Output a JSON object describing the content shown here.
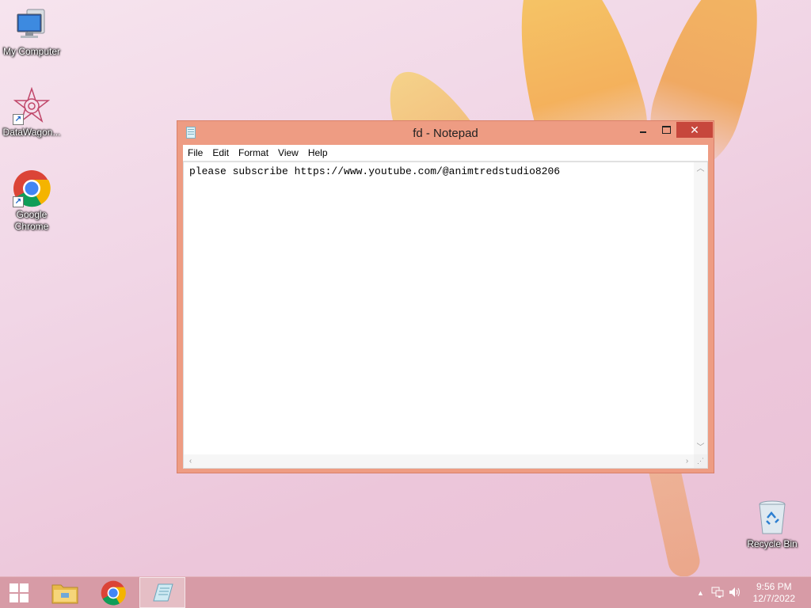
{
  "desktop": {
    "icons": [
      {
        "label": "My Computer",
        "icon": "computer-icon"
      },
      {
        "label": "DataWagon...",
        "icon": "datawagon-icon"
      },
      {
        "label": "Google Chrome",
        "icon": "chrome-icon"
      },
      {
        "label": "Recycle Bin",
        "icon": "recycle-bin-icon"
      }
    ]
  },
  "notepad": {
    "title": "fd - Notepad",
    "menu": [
      "File",
      "Edit",
      "Format",
      "View",
      "Help"
    ],
    "content": "please subscribe https://www.youtube.com/@animtredstudio8206",
    "controls": {
      "minimize": "minimize-icon",
      "maximize": "maximize-icon",
      "close": "✕"
    }
  },
  "taskbar": {
    "pinned": [
      {
        "name": "start",
        "icon": "windows-icon"
      },
      {
        "name": "file-explorer",
        "icon": "folder-icon"
      },
      {
        "name": "chrome",
        "icon": "chrome-icon"
      },
      {
        "name": "notepad",
        "icon": "notepad-icon",
        "active": true
      }
    ],
    "tray": {
      "time": "9:56 PM",
      "date": "12/7/2022",
      "icons": [
        "show-hidden-icon",
        "network-icon",
        "volume-icon"
      ]
    }
  },
  "colors": {
    "window_frame": "#ee9c83",
    "close_button": "#c7473c",
    "taskbar": "#d79ba6"
  }
}
